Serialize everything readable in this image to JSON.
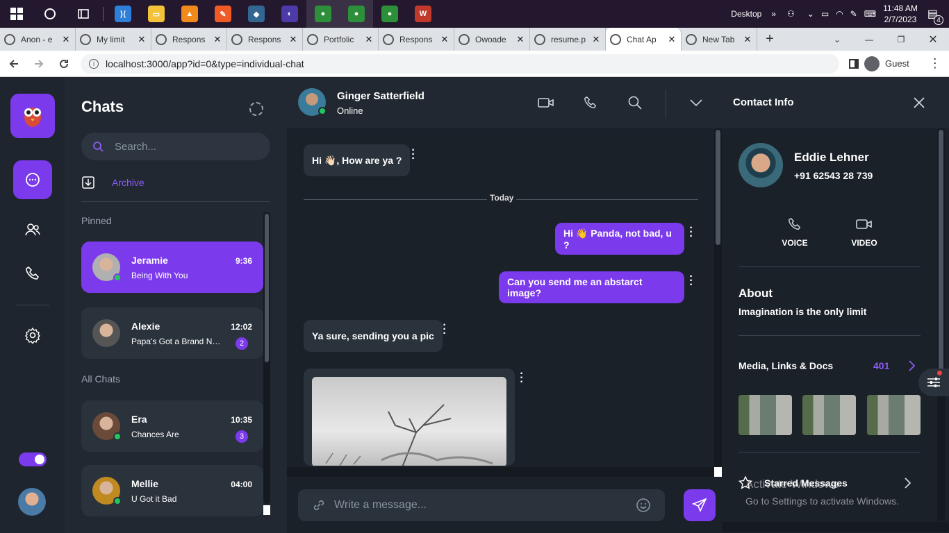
{
  "taskbar": {
    "apps": [
      {
        "name": "vscode-icon",
        "color": "#2f7ed8",
        "glyph": "⟩⟨"
      },
      {
        "name": "file-explorer-icon",
        "color": "#f3c13a",
        "glyph": "▭"
      },
      {
        "name": "vlc-icon",
        "color": "#f08a1c",
        "glyph": "▲"
      },
      {
        "name": "postman-icon",
        "color": "#ef5b25",
        "glyph": "✎"
      },
      {
        "name": "postgres-icon",
        "color": "#336791",
        "glyph": "◆"
      },
      {
        "name": "eclipse-icon",
        "color": "#4b3aa8",
        "glyph": "◐"
      },
      {
        "name": "chrome-icon",
        "color": "#2d8f3a",
        "glyph": "●"
      },
      {
        "name": "chrome-guest-icon",
        "color": "#2d8f3a",
        "glyph": "●"
      },
      {
        "name": "chrome-profile-icon",
        "color": "#2d8f3a",
        "glyph": "●"
      },
      {
        "name": "app-icon",
        "color": "#c0392b",
        "glyph": "W"
      }
    ],
    "desktop_label": "Desktop",
    "time": "11:48 AM",
    "date": "2/7/2023",
    "notif_count": "4"
  },
  "browser": {
    "tabs": [
      {
        "title": "Anon - e"
      },
      {
        "title": "My limit"
      },
      {
        "title": "Respons"
      },
      {
        "title": "Respons"
      },
      {
        "title": "Portfolic"
      },
      {
        "title": "Respons"
      },
      {
        "title": "Owoade"
      },
      {
        "title": "resume.p"
      },
      {
        "title": "Chat Ap"
      },
      {
        "title": "New Tab"
      }
    ],
    "url": "localhost:3000/app?id=0&type=individual-chat",
    "profile": "Guest"
  },
  "chats": {
    "title": "Chats",
    "search_placeholder": "Search...",
    "archive": "Archive",
    "pinned_label": "Pinned",
    "all_label": "All Chats",
    "pinned": [
      {
        "name": "Jeramie",
        "msg": "Being With You",
        "time": "9:36",
        "online": true,
        "color": "#b0b0b0"
      },
      {
        "name": "Alexie",
        "msg": "Papa's Got a Brand New Pig Bag",
        "time": "12:02",
        "badge": "2",
        "online": false,
        "color": "#555"
      }
    ],
    "all": [
      {
        "name": "Era",
        "msg": "Chances Are",
        "time": "10:35",
        "badge": "3",
        "online": true,
        "color": "#6b4a3a"
      },
      {
        "name": "Mellie",
        "msg": "U Got it Bad",
        "time": "04:00",
        "online": true,
        "color": "#c08a20"
      }
    ]
  },
  "conversation": {
    "name": "Ginger Satterfield",
    "status": "Online",
    "messages": [
      {
        "text": "Hi 👋🏻, How are ya ?",
        "dir": "in"
      },
      {
        "text": "Hi 👋 Panda, not bad, u ?",
        "dir": "out"
      },
      {
        "text": "Can you send me an abstarct image?",
        "dir": "out"
      },
      {
        "text": "Ya sure, sending you a pic",
        "dir": "in"
      }
    ],
    "divider": "Today",
    "composer_placeholder": "Write a message..."
  },
  "info": {
    "title": "Contact Info",
    "name": "Eddie Lehner",
    "phone": "+91 62543 28 739",
    "voice": "VOICE",
    "video": "VIDEO",
    "about_title": "About",
    "about_text": "Imagination is the only limit",
    "media_title": "Media, Links & Docs",
    "media_count": "401",
    "starred": "Starred Messages"
  },
  "watermark": {
    "line1": "Activate Windows",
    "line2": "Go to Settings to activate Windows."
  }
}
